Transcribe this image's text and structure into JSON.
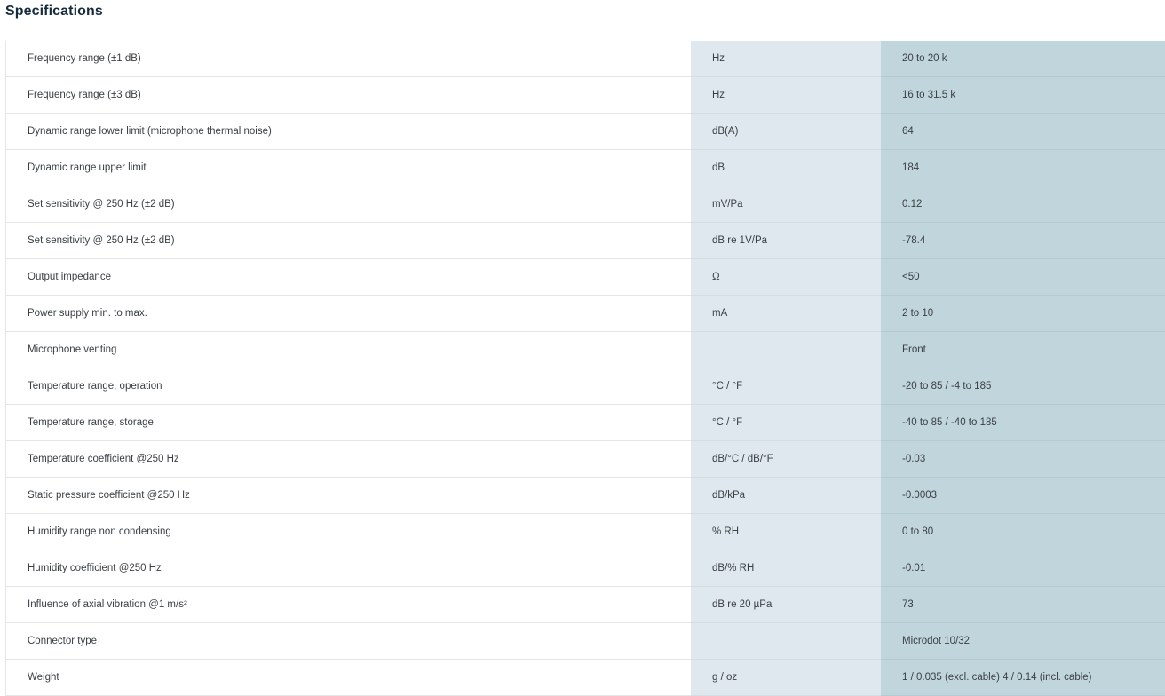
{
  "page": {
    "title": "Specifications"
  },
  "specs": [
    {
      "parameter": "Frequency range (±1 dB)",
      "unit": "Hz",
      "value": "20 to 20 k"
    },
    {
      "parameter": "Frequency range (±3 dB)",
      "unit": "Hz",
      "value": "16 to 31.5 k"
    },
    {
      "parameter": "Dynamic range lower limit (microphone thermal noise)",
      "unit": "dB(A)",
      "value": "64"
    },
    {
      "parameter": "Dynamic range upper limit",
      "unit": "dB",
      "value": "184"
    },
    {
      "parameter": "Set sensitivity @ 250 Hz (±2 dB)",
      "unit": "mV/Pa",
      "value": "0.12"
    },
    {
      "parameter": "Set sensitivity @ 250 Hz (±2 dB)",
      "unit": "dB re 1V/Pa",
      "value": "-78.4"
    },
    {
      "parameter": "Output impedance",
      "unit": "Ω",
      "value": "<50"
    },
    {
      "parameter": "Power supply min. to max.",
      "unit": "mA",
      "value": "2 to 10"
    },
    {
      "parameter": "Microphone venting",
      "unit": "",
      "value": "Front"
    },
    {
      "parameter": "Temperature range, operation",
      "unit": "°C / °F",
      "value": "-20 to 85 / -4 to 185"
    },
    {
      "parameter": "Temperature range, storage",
      "unit": "°C / °F",
      "value": "-40 to 85 / -40 to 185"
    },
    {
      "parameter": "Temperature coefficient @250 Hz",
      "unit": "dB/°C / dB/°F",
      "value": "-0.03"
    },
    {
      "parameter": "Static pressure coefficient @250 Hz",
      "unit": "dB/kPa",
      "value": "-0.0003"
    },
    {
      "parameter": "Humidity range non condensing",
      "unit": "% RH",
      "value": "0 to 80"
    },
    {
      "parameter": "Humidity coefficient @250 Hz",
      "unit": "dB/% RH",
      "value": "-0.01"
    },
    {
      "parameter": "Influence of axial vibration @1 m/s²",
      "unit": "dB re 20 µPa",
      "value": "73"
    },
    {
      "parameter": "Connector type",
      "unit": "",
      "value": "Microdot 10/32"
    },
    {
      "parameter": "Weight",
      "unit": "g / oz",
      "value": "1 / 0.035 (excl. cable) 4 / 0.14 (incl. cable)"
    }
  ],
  "colors": {
    "title": "#152b3c",
    "text": "#3a3f44",
    "unit_column_bg": "#dfe8ee",
    "value_column_bg": "#c1d5dc",
    "row_divider": "#e3e7ea"
  }
}
